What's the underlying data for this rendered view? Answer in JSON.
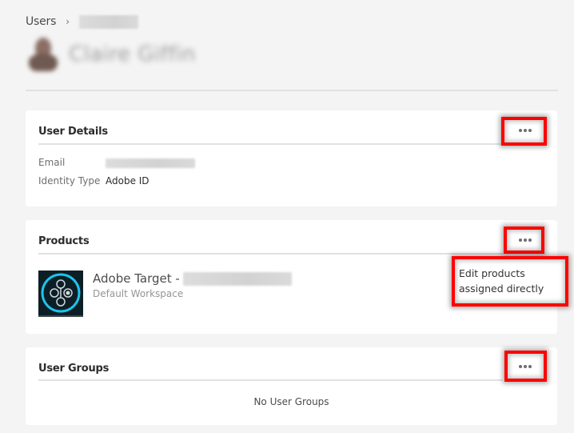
{
  "breadcrumb": {
    "root_label": "Users",
    "separator": "›",
    "current_redacted": true
  },
  "profile": {
    "name": "Claire Giffin",
    "name_redacted": true,
    "avatar_redacted": true
  },
  "cards": {
    "user_details": {
      "title": "User Details",
      "more_icon": "more-horizontal-icon",
      "rows": [
        {
          "label": "Email",
          "value": "",
          "redacted": true
        },
        {
          "label": "Identity Type",
          "value": "Adobe ID"
        }
      ]
    },
    "products": {
      "title": "Products",
      "more_icon": "more-horizontal-icon",
      "items": [
        {
          "icon": "adobe-target-icon",
          "name_prefix": "Adobe Target -",
          "name_suffix_redacted": true,
          "subtitle": "Default Workspace"
        }
      ],
      "menu": {
        "items": [
          {
            "label": "Edit products assigned directly"
          }
        ]
      }
    },
    "user_groups": {
      "title": "User Groups",
      "more_icon": "more-horizontal-icon",
      "empty_text": "No User Groups"
    }
  },
  "annotations": {
    "highlight_color": "#ff0000"
  },
  "colors": {
    "page_background": "#f4f4f4",
    "card_background": "#ffffff",
    "target_accent": "#1fc3eb"
  }
}
